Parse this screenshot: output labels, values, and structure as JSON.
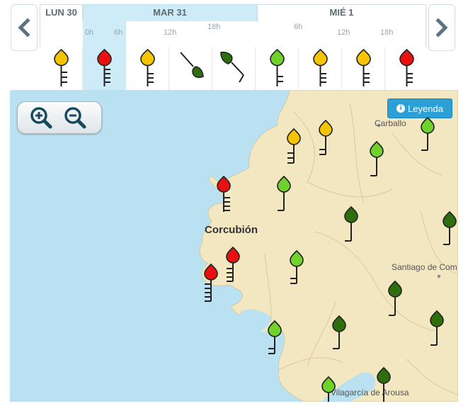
{
  "timeline": {
    "days": [
      "LUN 30",
      "MAR 31",
      "MIÉ 1"
    ],
    "hours": [
      "0h",
      "6h",
      "12h",
      "18h",
      "6h",
      "12h",
      "18h"
    ],
    "slots": [
      {
        "status": "yellow",
        "icon": "wind-barb-icon"
      },
      {
        "status": "red",
        "icon": "wind-barb-icon"
      },
      {
        "status": "yellow",
        "icon": "wind-barb-icon"
      },
      {
        "status": "dark-green",
        "icon": "wind-barb-icon"
      },
      {
        "status": "dark-green",
        "icon": "wind-barb-icon"
      },
      {
        "status": "light-green",
        "icon": "wind-barb-icon"
      },
      {
        "status": "yellow",
        "icon": "wind-barb-icon"
      },
      {
        "status": "yellow",
        "icon": "wind-barb-icon"
      },
      {
        "status": "red",
        "icon": "wind-barb-icon"
      }
    ],
    "prev_icon": "chevron-left-icon",
    "next_icon": "chevron-right-icon"
  },
  "map": {
    "zoom_in_icon": "zoom-in-icon",
    "zoom_out_icon": "zoom-out-icon",
    "legend_label": "Leyenda",
    "legend_icon": "info-icon",
    "places": [
      "Carballo",
      "Corcubión",
      "Santiago de Com",
      "Vilagarcía de Arousa"
    ],
    "markers": [
      {
        "status": "yellow"
      },
      {
        "status": "yellow"
      },
      {
        "status": "light-green"
      },
      {
        "status": "light-green"
      },
      {
        "status": "red"
      },
      {
        "status": "light-green"
      },
      {
        "status": "dark-green"
      },
      {
        "status": "dark-green"
      },
      {
        "status": "red"
      },
      {
        "status": "red"
      },
      {
        "status": "light-green"
      },
      {
        "status": "dark-green"
      },
      {
        "status": "dark-green"
      },
      {
        "status": "light-green"
      },
      {
        "status": "dark-green"
      },
      {
        "status": "light-green"
      },
      {
        "status": "dark-green"
      }
    ]
  },
  "colors": {
    "yellow": "#f5c400",
    "red": "#e81010",
    "light-green": "#6fd12a",
    "dark-green": "#2f6e0c",
    "sea": "#b9e1f1",
    "land": "#f3e7c1",
    "accent": "#2b9fd6"
  }
}
